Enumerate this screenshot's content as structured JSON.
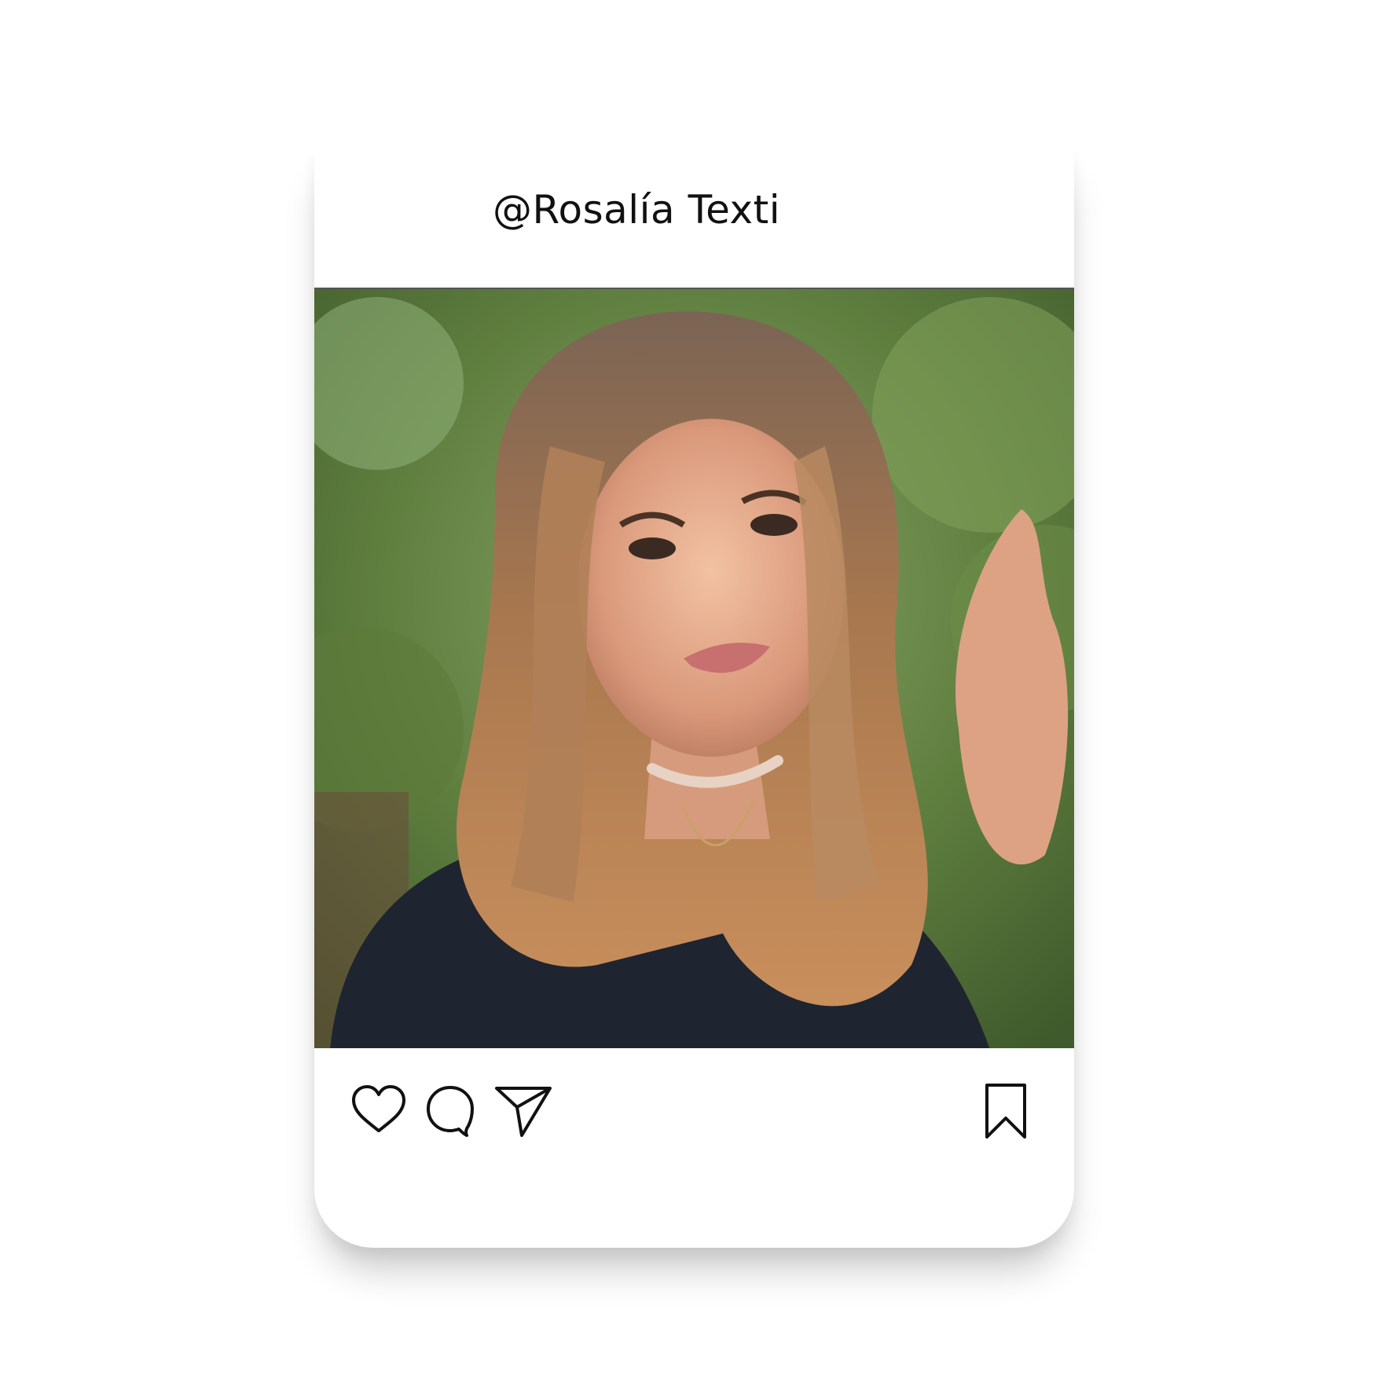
{
  "post": {
    "username": "@Rosalía Texti",
    "photo_subject": "portrait-photo",
    "actions": {
      "like_icon": "heart-icon",
      "comment_icon": "comment-icon",
      "share_icon": "send-icon",
      "save_icon": "bookmark-icon"
    }
  }
}
